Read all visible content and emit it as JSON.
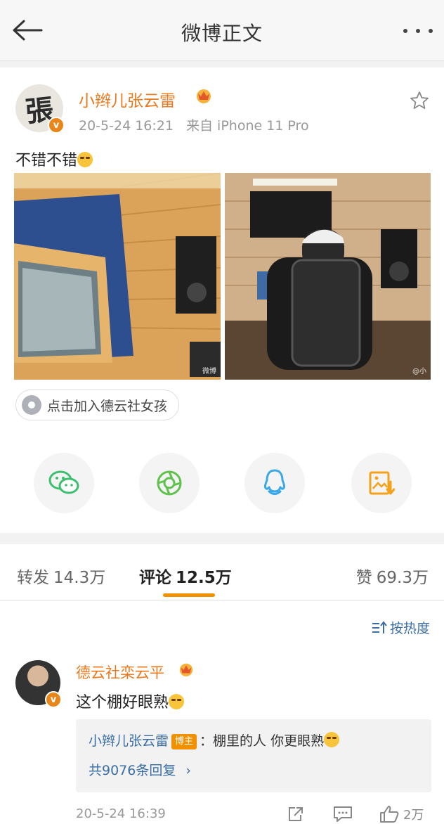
{
  "nav": {
    "title": "微博正文",
    "back_icon": "arrow-left-icon",
    "more_icon": "more-dots-icon"
  },
  "post": {
    "author": "小辫儿张云雷",
    "avatar_text": "張",
    "time": "20-5-24 16:21",
    "source": "来自 iPhone 11 Pro",
    "text": "不错不错",
    "photo_watermark_1": "微博",
    "photo_watermark_2": "@小",
    "topic": "点击加入德云社女孩",
    "share_icons": [
      "wechat-icon",
      "moments-icon",
      "qq-icon",
      "save-image-icon"
    ]
  },
  "tabs": [
    {
      "label": "转发",
      "count": "14.3万"
    },
    {
      "label": "评论",
      "count": "12.5万"
    },
    {
      "label": "赞",
      "count": "69.3万"
    }
  ],
  "comments": {
    "sort_label": "按热度",
    "items": [
      {
        "author": "德云社栾云平",
        "text": "这个棚好眼熟",
        "reply_author": "小辫儿张云雷",
        "reply_badge": "博主",
        "reply_text": "：棚里的人 你更眼熟",
        "reply_more": "共9076条回复",
        "time": "20-5-24 16:39",
        "likes": "2万"
      }
    ]
  },
  "colors": {
    "accent": "#e8791f",
    "link": "#3a6ea5",
    "tab_underline": "#f29100"
  }
}
